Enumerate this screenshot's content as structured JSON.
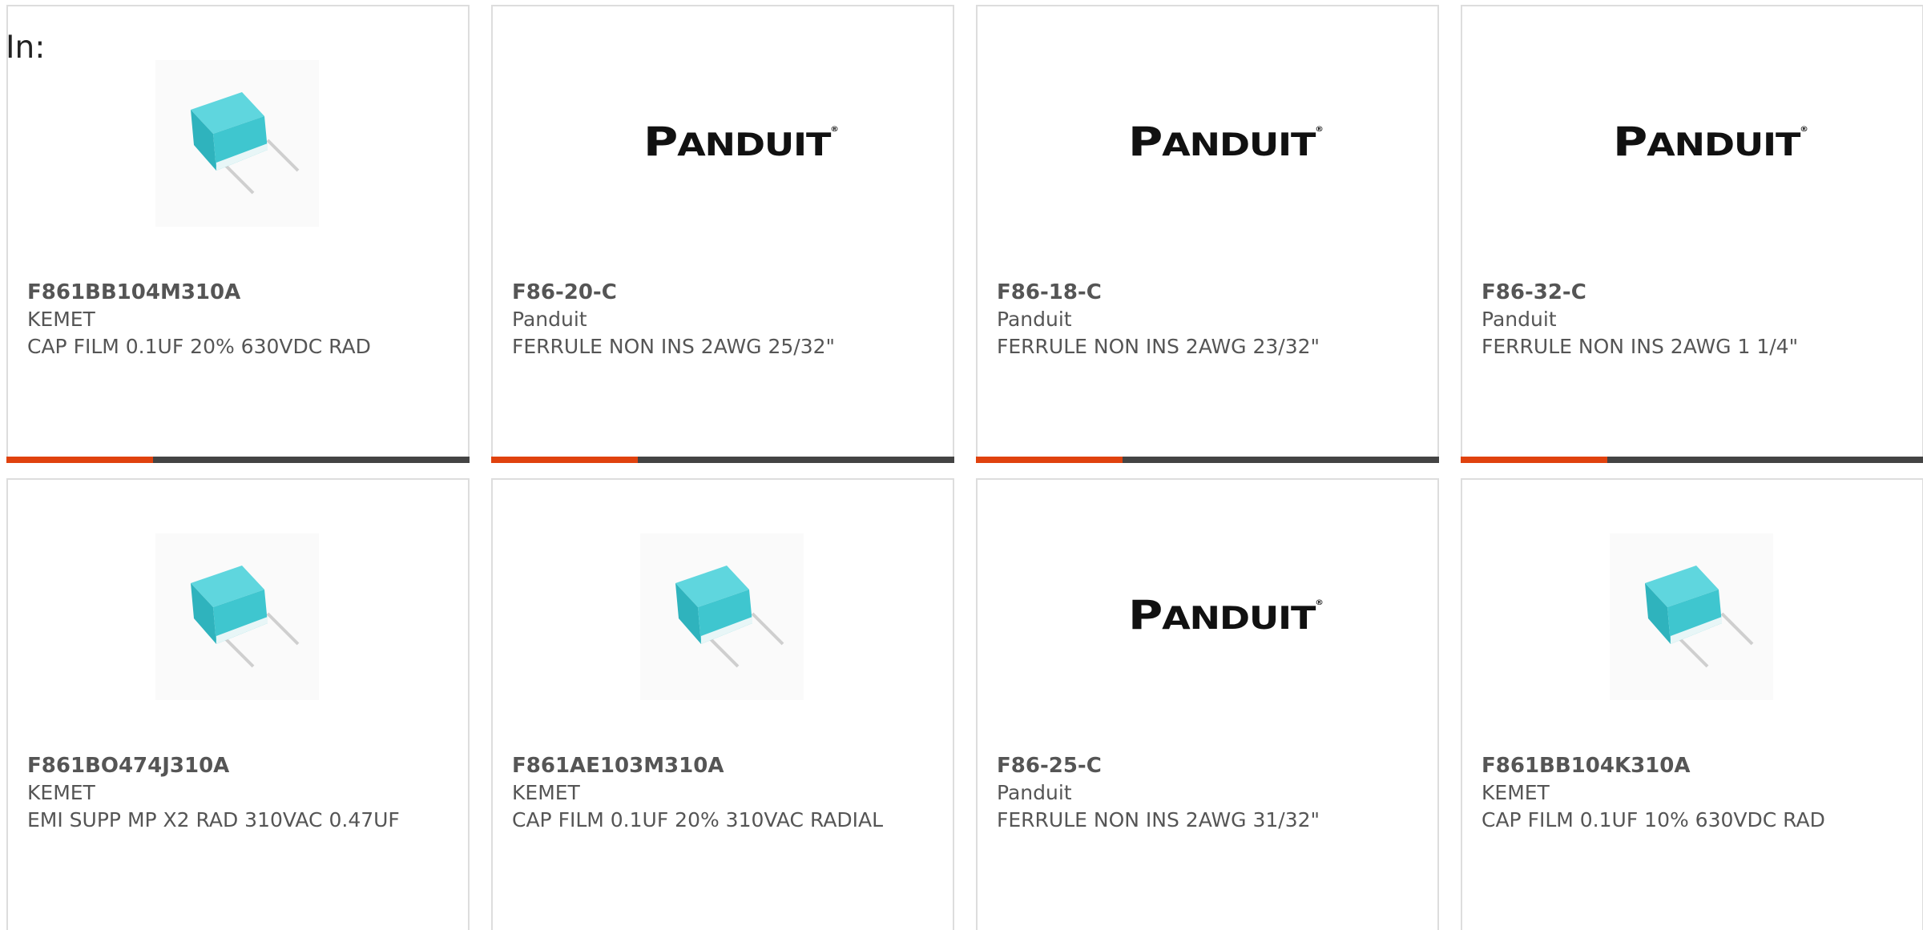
{
  "header": {
    "in_label": "In:"
  },
  "colors": {
    "accent": "#e0420e",
    "bar": "#444444",
    "capacitor": "#3fc6cf"
  },
  "products": [
    {
      "part_number": "F861BB104M310A",
      "manufacturer": "KEMET",
      "description": "CAP FILM 0.1UF 20% 630VDC RAD",
      "image": "capacitor-image"
    },
    {
      "part_number": "F86-20-C",
      "manufacturer": "Panduit",
      "description": "FERRULE NON INS 2AWG 25/32\"",
      "image": "panduit-logo"
    },
    {
      "part_number": "F86-18-C",
      "manufacturer": "Panduit",
      "description": "FERRULE NON INS 2AWG 23/32\"",
      "image": "panduit-logo"
    },
    {
      "part_number": "F86-32-C",
      "manufacturer": "Panduit",
      "description": "FERRULE NON INS 2AWG 1 1/4\"",
      "image": "panduit-logo"
    },
    {
      "part_number": "F861BO474J310A",
      "manufacturer": "KEMET",
      "description": "EMI SUPP MP X2 RAD 310VAC 0.47UF",
      "image": "capacitor-image"
    },
    {
      "part_number": "F861AE103M310A",
      "manufacturer": "KEMET",
      "description": "CAP FILM 0.1UF 20% 310VAC RADIAL",
      "image": "capacitor-image"
    },
    {
      "part_number": "F86-25-C",
      "manufacturer": "Panduit",
      "description": "FERRULE NON INS 2AWG 31/32\"",
      "image": "panduit-logo"
    },
    {
      "part_number": "F861BB104K310A",
      "manufacturer": "KEMET",
      "description": "CAP FILM 0.1UF 10% 630VDC RAD",
      "image": "capacitor-image"
    }
  ],
  "logo_text": {
    "panduit_first": "P",
    "panduit_rest": "ANDUIT",
    "panduit_reg": "®"
  }
}
